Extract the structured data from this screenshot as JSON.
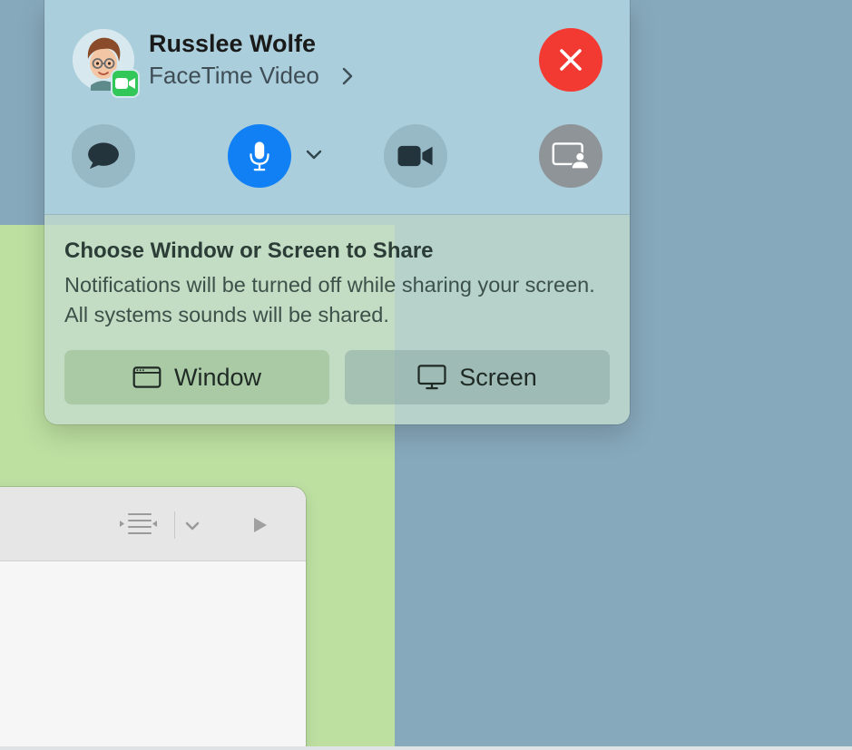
{
  "caller": {
    "name": "Russlee Wolfe",
    "call_type": "FaceTime Video",
    "avatar_icon": "memoji-avatar-icon",
    "badge_icon": "facetime-app-icon"
  },
  "controls": {
    "end_call_icon": "close-icon",
    "messages_icon": "message-bubble-icon",
    "microphone_icon": "microphone-icon",
    "microphone_menu_icon": "chevron-down-icon",
    "camera_icon": "video-camera-icon",
    "screen_share_icon": "screen-share-icon"
  },
  "share": {
    "title": "Choose Window or Screen to Share",
    "description": "Notifications will be turned off while sharing your screen. All systems sounds will be shared.",
    "window_label": "Window",
    "screen_label": "Screen"
  },
  "colors": {
    "end_call": "#f33a32",
    "mic_active": "#1180f5",
    "facetime_green": "#31c759"
  }
}
